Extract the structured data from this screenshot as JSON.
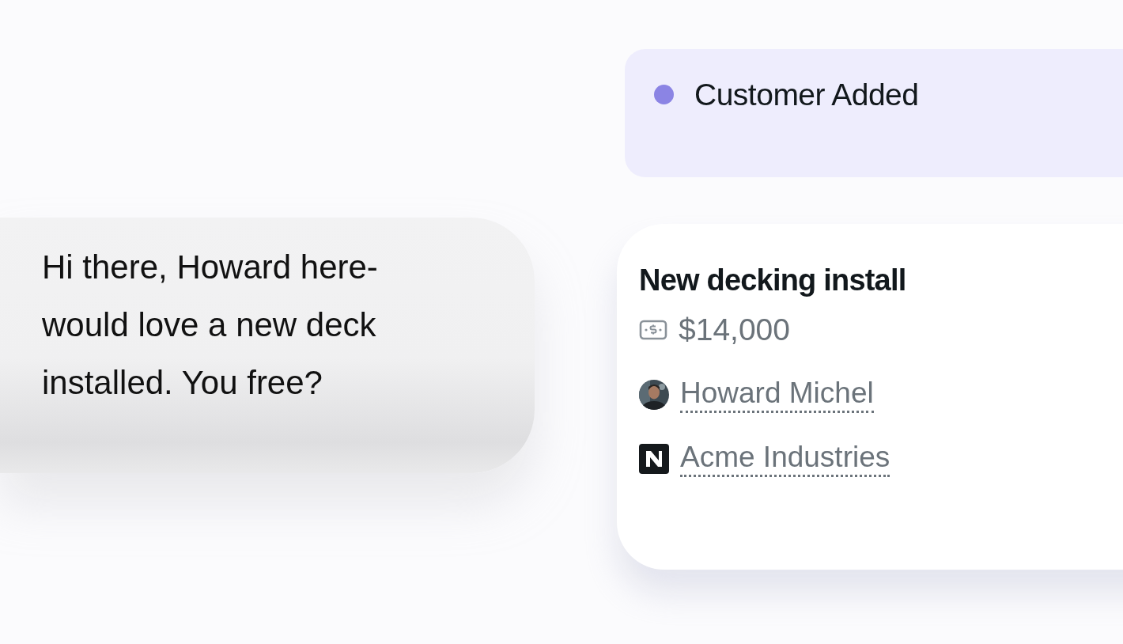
{
  "status": {
    "label": "Customer Added",
    "color": "#8b84e4"
  },
  "message": {
    "text": "Hi there, Howard here-would love a new deck installed. You free?"
  },
  "deal": {
    "title": "New decking install",
    "amount": "$14,000",
    "contact": {
      "name": "Howard Michel"
    },
    "company": {
      "name": "Acme Industries"
    }
  }
}
